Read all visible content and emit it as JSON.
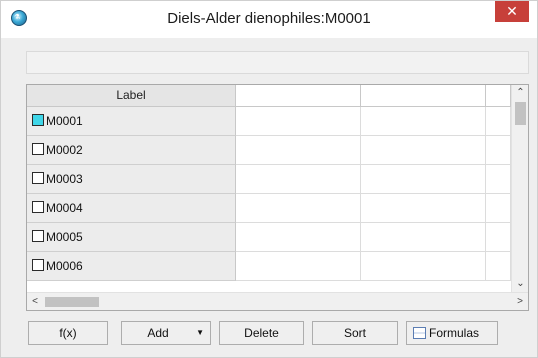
{
  "window": {
    "title": "Diels-Alder dienophiles:M0001",
    "app_icon": "ambrosia-app-icon",
    "close_glyph": "✕"
  },
  "grid": {
    "header_label": "Label",
    "extra_columns": [
      "",
      "",
      ""
    ],
    "rows": [
      {
        "label": "M0001",
        "checked": true
      },
      {
        "label": "M0002",
        "checked": false
      },
      {
        "label": "M0003",
        "checked": false
      },
      {
        "label": "M0004",
        "checked": false
      },
      {
        "label": "M0005",
        "checked": false
      },
      {
        "label": "M0006",
        "checked": false
      }
    ]
  },
  "scrollbars": {
    "up": "⌃",
    "down": "⌄",
    "left": "<",
    "right": ">"
  },
  "buttons": {
    "fx": "f(x)",
    "add": "Add",
    "add_caret": "▼",
    "delete": "Delete",
    "sort": "Sort",
    "formulas": "Formulas"
  },
  "colors": {
    "close": "#c7403a",
    "checked_swatch": "#3fd6e8"
  }
}
